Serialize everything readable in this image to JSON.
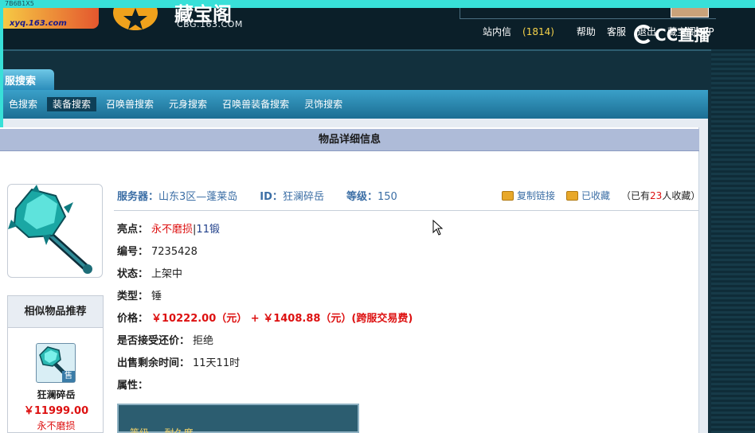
{
  "header": {
    "tiny_label": "7B6B1X5",
    "left_logo_url": "xyq.163.com",
    "site_title": "藏宝阁",
    "site_url": "CBG.163.COM",
    "topnav": [
      {
        "label": "站内信",
        "count": "(1814)"
      },
      {
        "label": "帮助"
      },
      {
        "label": "客服"
      },
      {
        "label": "退出"
      },
      {
        "label": "藏宝阁APP"
      }
    ],
    "watermark": "CC直播"
  },
  "tabs": {
    "main_tab": "服搜索",
    "sub_items": [
      "色搜索",
      "装备搜索",
      "召唤兽搜索",
      "元身搜索",
      "召唤兽装备搜索",
      "灵饰搜索"
    ],
    "active_index": 1
  },
  "detail": {
    "title": "物品详细信息",
    "server_label": "服务器：",
    "server_value": "山东3区—蓬莱岛",
    "id_label": "ID：",
    "id_value": "狂澜碎岳",
    "level_label": "等级：",
    "level_value": "150",
    "copy_link": "复制链接",
    "favorited": "已收藏",
    "fav_prefix": "（已有",
    "fav_count": "23",
    "fav_suffix": "人收藏）",
    "highlight_label": "亮点：",
    "highlight_value1": "永不磨损",
    "highlight_sep": "|",
    "highlight_value2": "11锻",
    "number_label": "编号：",
    "number_value": "7235428",
    "status_label": "状态：",
    "status_value": "上架中",
    "type_label": "类型：",
    "type_value": "锤",
    "price_label": "价格：",
    "price_value": "￥10222.00（元）  +  ￥1408.88（元）(跨服交易费)",
    "counter_label": "是否接受还价：",
    "counter_value": "拒绝",
    "remaining_label": "出售剩余时间：",
    "remaining_value": "11天11时",
    "props_label": "属性：",
    "props_peek": "等级 … 耐久度 …"
  },
  "similar": {
    "title": "相似物品推荐",
    "badge": "售",
    "name": "狂澜碎岳",
    "price": "￥11999.00",
    "highlight": "永不磨损"
  },
  "colors": {
    "accent_red": "#d11111",
    "link_blue": "#3b6ea5",
    "subnav_blue": "#1c6e93",
    "title_bar": "#aebbd8"
  }
}
